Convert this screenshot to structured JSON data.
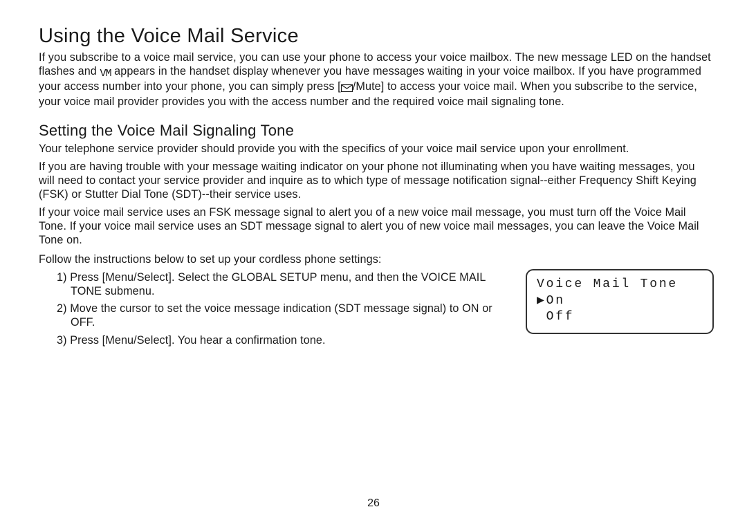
{
  "mainTitle": "Using the Voice Mail Service",
  "intro": {
    "part1": "If you subscribe to a voice mail service, you can use your phone to access your voice mailbox. The new message LED on the handset flashes and ",
    "vmIconText": "VM",
    "part2": " appears in the handset display whenever you have messages waiting in your voice mailbox. If you have programmed your access number into your phone, you can simply press [",
    "muteText": "/Mute] to access your voice mail. When you subscribe to the service, your voice mail provider provides you with the access number and the required voice mail signaling tone."
  },
  "subTitle": "Setting the Voice Mail Signaling Tone",
  "para1": "Your telephone service provider should provide you with the specifics of your voice mail service upon your enrollment.",
  "para2": "If you are having trouble with your message waiting indicator on your phone not illuminating when you have waiting messages, you will need to contact your service provider and inquire as to which type of message notification signal--either Frequency Shift Keying (FSK) or Stutter Dial Tone (SDT)--their service uses.",
  "para3": "If your voice mail service uses an FSK message signal to alert you of a new voice mail message, you must turn off the Voice Mail Tone. If your voice mail service uses an SDT message signal to alert you of new voice mail messages, you can leave the Voice Mail Tone on.",
  "instrLead": "Follow the instructions below to set up your cordless phone settings:",
  "steps": [
    "1) Press [Menu/Select]. Select the GLOBAL SETUP menu, and then the VOICE MAIL TONE submenu.",
    "2) Move the cursor to set the voice message indication (SDT message signal) to ON or OFF.",
    "3) Press [Menu/Select]. You hear a confirmation tone."
  ],
  "lcd": {
    "line1": "Voice Mail Tone",
    "line2": "▶On",
    "line3": " Off"
  },
  "pageNum": "26"
}
